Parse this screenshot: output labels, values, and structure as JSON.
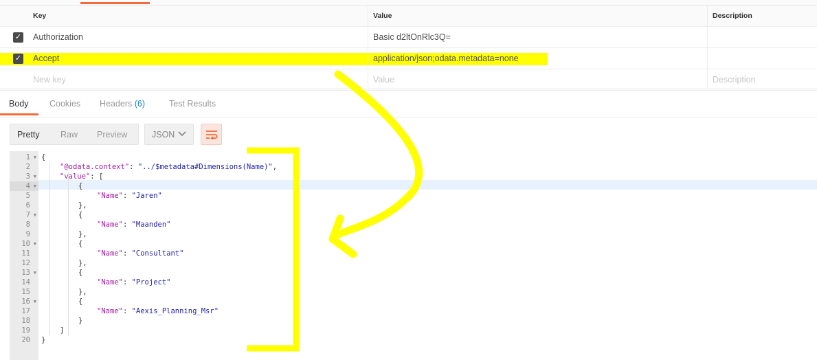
{
  "headers_table": {
    "columns": {
      "key": "Key",
      "value": "Value",
      "description": "Description"
    },
    "rows": [
      {
        "key": "Authorization",
        "value": "Basic d2ltOnRlc3Q=",
        "checked": true,
        "highlighted": false
      },
      {
        "key": "Accept",
        "value": "application/json;odata.metadata=none",
        "checked": true,
        "highlighted": true
      }
    ],
    "new_row": {
      "key_placeholder": "New key",
      "value_placeholder": "Value",
      "description_placeholder": "Description"
    }
  },
  "response_tabs": [
    {
      "label": "Body",
      "active": true
    },
    {
      "label": "Cookies",
      "active": false
    },
    {
      "label": "Headers",
      "count": "(6)",
      "active": false
    },
    {
      "label": "Test Results",
      "active": false
    }
  ],
  "view_modes": [
    "Pretty",
    "Raw",
    "Preview"
  ],
  "format_select": {
    "selected": "JSON"
  },
  "editor": {
    "active_line": 4,
    "lines": [
      {
        "n": "1",
        "fold": true,
        "indent": 0,
        "parts": [
          {
            "t": "p",
            "v": "{"
          }
        ]
      },
      {
        "n": "2",
        "fold": false,
        "indent": 1,
        "parts": [
          {
            "t": "k",
            "v": "\"@odata.context\""
          },
          {
            "t": "p",
            "v": ": "
          },
          {
            "t": "s",
            "v": "\"../$metadata#Dimensions(Name)\""
          },
          {
            "t": "p",
            "v": ","
          }
        ]
      },
      {
        "n": "3",
        "fold": true,
        "indent": 1,
        "parts": [
          {
            "t": "k",
            "v": "\"value\""
          },
          {
            "t": "p",
            "v": ": ["
          }
        ]
      },
      {
        "n": "4",
        "fold": true,
        "indent": 2,
        "parts": [
          {
            "t": "p",
            "v": "{"
          }
        ]
      },
      {
        "n": "5",
        "fold": false,
        "indent": 3,
        "parts": [
          {
            "t": "k",
            "v": "\"Name\""
          },
          {
            "t": "p",
            "v": ": "
          },
          {
            "t": "s",
            "v": "\"Jaren\""
          }
        ]
      },
      {
        "n": "6",
        "fold": false,
        "indent": 2,
        "parts": [
          {
            "t": "p",
            "v": "},"
          }
        ]
      },
      {
        "n": "7",
        "fold": true,
        "indent": 2,
        "parts": [
          {
            "t": "p",
            "v": "{"
          }
        ]
      },
      {
        "n": "8",
        "fold": false,
        "indent": 3,
        "parts": [
          {
            "t": "k",
            "v": "\"Name\""
          },
          {
            "t": "p",
            "v": ": "
          },
          {
            "t": "s",
            "v": "\"Maanden\""
          }
        ]
      },
      {
        "n": "9",
        "fold": false,
        "indent": 2,
        "parts": [
          {
            "t": "p",
            "v": "},"
          }
        ]
      },
      {
        "n": "10",
        "fold": true,
        "indent": 2,
        "parts": [
          {
            "t": "p",
            "v": "{"
          }
        ]
      },
      {
        "n": "11",
        "fold": false,
        "indent": 3,
        "parts": [
          {
            "t": "k",
            "v": "\"Name\""
          },
          {
            "t": "p",
            "v": ": "
          },
          {
            "t": "s",
            "v": "\"Consultant\""
          }
        ]
      },
      {
        "n": "12",
        "fold": false,
        "indent": 2,
        "parts": [
          {
            "t": "p",
            "v": "},"
          }
        ]
      },
      {
        "n": "13",
        "fold": true,
        "indent": 2,
        "parts": [
          {
            "t": "p",
            "v": "{"
          }
        ]
      },
      {
        "n": "14",
        "fold": false,
        "indent": 3,
        "parts": [
          {
            "t": "k",
            "v": "\"Name\""
          },
          {
            "t": "p",
            "v": ": "
          },
          {
            "t": "s",
            "v": "\"Project\""
          }
        ]
      },
      {
        "n": "15",
        "fold": false,
        "indent": 2,
        "parts": [
          {
            "t": "p",
            "v": "},"
          }
        ]
      },
      {
        "n": "16",
        "fold": true,
        "indent": 2,
        "parts": [
          {
            "t": "p",
            "v": "{"
          }
        ]
      },
      {
        "n": "17",
        "fold": false,
        "indent": 3,
        "parts": [
          {
            "t": "k",
            "v": "\"Name\""
          },
          {
            "t": "p",
            "v": ": "
          },
          {
            "t": "s",
            "v": "\"Aexis_Planning_Msr\""
          }
        ]
      },
      {
        "n": "18",
        "fold": false,
        "indent": 2,
        "parts": [
          {
            "t": "p",
            "v": "}"
          }
        ]
      },
      {
        "n": "19",
        "fold": false,
        "indent": 1,
        "parts": [
          {
            "t": "p",
            "v": "]"
          }
        ]
      },
      {
        "n": "20",
        "fold": false,
        "indent": 0,
        "parts": [
          {
            "t": "p",
            "v": "}"
          }
        ]
      }
    ]
  },
  "colors": {
    "accent": "#f26b3a",
    "highlight": "#ffff00",
    "json_key": "#a31ea3",
    "json_string": "#2424a8",
    "badge": "#0c84d4"
  }
}
